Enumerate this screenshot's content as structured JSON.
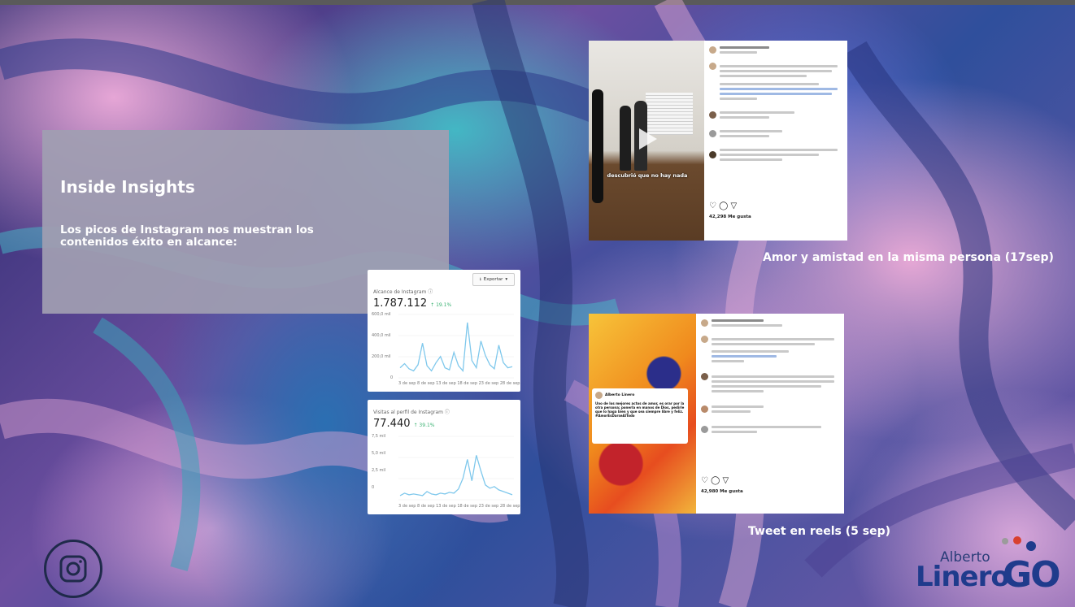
{
  "slide": {
    "title": "Inside Insights",
    "description": "Los picos de Instagram nos muestran los contenidos éxito en alcance:"
  },
  "chart_reach": {
    "label": "Alcance de Instagram ⓘ",
    "value": "1.787.112",
    "delta": "↑ 19.1%",
    "export_label": "Exportar",
    "y_ticks": [
      "600,0 mil",
      "400,0 mil",
      "200,0 mil",
      "0"
    ],
    "x_ticks_text": "3 de sep 8 de sep 13 de sep 18 de sep 23 de sep 28 de sep"
  },
  "chart_profile": {
    "label": "Visitas al perfil de Instagram ⓘ",
    "value": "77.440",
    "delta": "↑ 39.1%",
    "y_ticks": [
      "7,5 mil",
      "5,0 mil",
      "2,5 mil",
      "0"
    ],
    "x_ticks_text": "3 de sep 8 de sep 13 de sep 18 de sep 23 de sep 28 de sep"
  },
  "chart_data": [
    {
      "type": "line",
      "title": "Alcance de Instagram",
      "ylim": [
        0,
        600000
      ],
      "x": [
        "3 de sep",
        "",
        "",
        "",
        "",
        "8 de sep",
        "",
        "",
        "",
        "",
        "13 de sep",
        "",
        "",
        "",
        "",
        "18 de sep",
        "",
        "",
        "",
        "",
        "23 de sep",
        "",
        "",
        "",
        "",
        "28 de sep"
      ],
      "values": [
        90000,
        130000,
        80000,
        60000,
        120000,
        330000,
        110000,
        60000,
        140000,
        200000,
        90000,
        70000,
        240000,
        110000,
        60000,
        530000,
        160000,
        90000,
        350000,
        210000,
        120000,
        80000,
        310000,
        140000,
        90000,
        100000
      ]
    },
    {
      "type": "line",
      "title": "Visitas al perfil de Instagram",
      "ylim": [
        0,
        7500
      ],
      "x": [
        "3 de sep",
        "",
        "",
        "",
        "",
        "8 de sep",
        "",
        "",
        "",
        "",
        "13 de sep",
        "",
        "",
        "",
        "",
        "18 de sep",
        "",
        "",
        "",
        "",
        "23 de sep",
        "",
        "",
        "",
        "",
        "28 de sep"
      ],
      "values": [
        400,
        700,
        500,
        600,
        500,
        400,
        900,
        600,
        500,
        700,
        600,
        800,
        700,
        1200,
        2500,
        4800,
        2200,
        5300,
        3400,
        1700,
        1300,
        1500,
        1100,
        900,
        700,
        500
      ]
    }
  ],
  "post1": {
    "overlay_text": "descubrió que no hay nada",
    "likes": "42,298 Me gusta",
    "caption": "Amor y amistad en la misma persona (17sep)"
  },
  "post2": {
    "tweet_author": "Alberto Linero",
    "tweet_text": "Uno de los mejores actos de amor, es orar por la otra persona; ponerla en manos de Dios, pedirle que lo haga bien y que sea siempre libre y feliz. #AmorEsDarseAlTodo",
    "likes": "42,980 Me gusta",
    "caption": "Tweet en reels (5 sep)"
  },
  "brand": {
    "line1": "Alberto",
    "line2": "Linero",
    "line3": "GO"
  },
  "colors": {
    "box": "#a09eb2",
    "chart_line": "#7fc8ec",
    "brand_blue": "#1f3b8c",
    "accent_red": "#d8402f",
    "accent_gray": "#9b9b9b"
  },
  "icons": {
    "social": "instagram-icon",
    "play": "play-icon",
    "export": "download-icon"
  }
}
